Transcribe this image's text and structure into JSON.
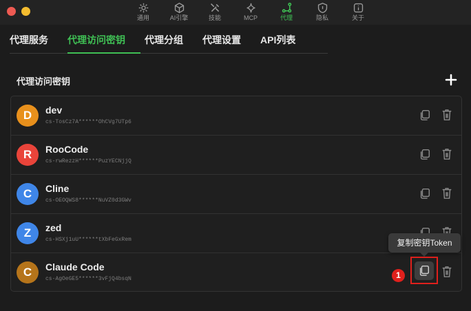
{
  "window": {
    "toolbar": [
      {
        "label": "通用",
        "icon": "gear-icon"
      },
      {
        "label": "AI引擎",
        "icon": "cube-icon"
      },
      {
        "label": "技能",
        "icon": "tools-icon"
      },
      {
        "label": "MCP",
        "icon": "sparkle-icon"
      },
      {
        "label": "代理",
        "icon": "proxy-icon",
        "active": true
      },
      {
        "label": "隐私",
        "icon": "shield-icon"
      },
      {
        "label": "关于",
        "icon": "info-icon"
      }
    ]
  },
  "tabs": [
    "代理服务",
    "代理访问密钥",
    "代理分组",
    "代理设置",
    "API列表"
  ],
  "active_tab": "代理访问密钥",
  "section": {
    "title": "代理访问密钥",
    "add_icon": "plus-icon"
  },
  "keys": [
    {
      "initial": "D",
      "name": "dev",
      "key": "cs-TosCz7A******OhCVg7UTp6",
      "color": "#e8901c"
    },
    {
      "initial": "R",
      "name": "RooCode",
      "key": "cs-rwRezzH******PuzYECNjjQ",
      "color": "#e9443a"
    },
    {
      "initial": "C",
      "name": "Cline",
      "key": "cs-OEOQWS8******NuVZ0d3GWv",
      "color": "#3f86e8"
    },
    {
      "initial": "Z",
      "name": "zed",
      "key": "cs-HSXj1uU******tXbFeGxRem",
      "color": "#3f86e8"
    },
    {
      "initial": "C",
      "name": "Claude Code",
      "key": "cs-AgOeGE5******3vFjQ4bsqN",
      "color": "#b5741a"
    }
  ],
  "tooltip": "复制密钥Token",
  "step_badge": "1",
  "colors": {
    "accent": "#3fbf54",
    "highlight": "#e0201c"
  }
}
